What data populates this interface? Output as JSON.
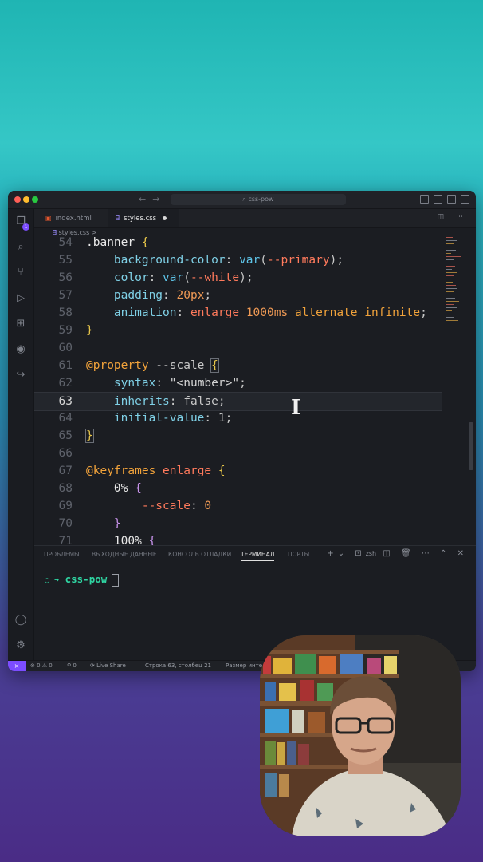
{
  "window": {
    "title": "css-pow"
  },
  "tabs": [
    {
      "label": "index.html",
      "icon": "html-file-icon"
    },
    {
      "label": "styles.css",
      "icon": "css-file-icon",
      "modified": true
    }
  ],
  "breadcrumb": {
    "file": "styles.css",
    "sep": ">"
  },
  "activity_badge": "1",
  "editor": {
    "current_line": 63,
    "lines": [
      {
        "n": "54",
        "tokens": [
          [
            "sel",
            ".banner "
          ],
          [
            "brace",
            "{"
          ]
        ]
      },
      {
        "n": "55",
        "tokens": [
          [
            "punc",
            "    "
          ],
          [
            "prop",
            "background-color"
          ],
          [
            "punc",
            ": "
          ],
          [
            "fn",
            "var"
          ],
          [
            "punc",
            "("
          ],
          [
            "var",
            "--primary"
          ],
          [
            "punc",
            ");"
          ]
        ]
      },
      {
        "n": "56",
        "tokens": [
          [
            "punc",
            "    "
          ],
          [
            "prop",
            "color"
          ],
          [
            "punc",
            ": "
          ],
          [
            "fn",
            "var"
          ],
          [
            "punc",
            "("
          ],
          [
            "var",
            "--white"
          ],
          [
            "punc",
            ");"
          ]
        ]
      },
      {
        "n": "57",
        "tokens": [
          [
            "punc",
            "    "
          ],
          [
            "prop",
            "padding"
          ],
          [
            "punc",
            ": "
          ],
          [
            "num",
            "20px"
          ],
          [
            "punc",
            ";"
          ]
        ]
      },
      {
        "n": "58",
        "tokens": [
          [
            "punc",
            "    "
          ],
          [
            "prop",
            "animation"
          ],
          [
            "punc",
            ": "
          ],
          [
            "var",
            "enlarge"
          ],
          [
            "punc",
            " "
          ],
          [
            "num",
            "1000ms"
          ],
          [
            "punc",
            " "
          ],
          [
            "kw",
            "alternate"
          ],
          [
            "punc",
            " "
          ],
          [
            "kw",
            "infinite"
          ],
          [
            "punc",
            ";"
          ]
        ]
      },
      {
        "n": "59",
        "tokens": [
          [
            "brace",
            "}"
          ]
        ]
      },
      {
        "n": "60",
        "tokens": []
      },
      {
        "n": "61",
        "tokens": [
          [
            "at",
            "@property"
          ],
          [
            "punc",
            " --scale "
          ],
          [
            "brace",
            "{"
          ]
        ]
      },
      {
        "n": "62",
        "tokens": [
          [
            "punc",
            "    "
          ],
          [
            "prop",
            "syntax"
          ],
          [
            "punc",
            ": "
          ],
          [
            "str",
            "\"<number>\""
          ],
          [
            "punc",
            ";"
          ]
        ]
      },
      {
        "n": "63",
        "tokens": [
          [
            "punc",
            "    "
          ],
          [
            "prop",
            "inherits"
          ],
          [
            "punc",
            ": "
          ],
          [
            "punc",
            "false"
          ],
          [
            "punc",
            ";"
          ]
        ]
      },
      {
        "n": "64",
        "tokens": [
          [
            "punc",
            "    "
          ],
          [
            "prop",
            "initial-value"
          ],
          [
            "punc",
            ": "
          ],
          [
            "punc",
            "1"
          ],
          [
            "punc",
            ";"
          ]
        ]
      },
      {
        "n": "65",
        "tokens": [
          [
            "brace",
            "}"
          ]
        ]
      },
      {
        "n": "66",
        "tokens": []
      },
      {
        "n": "67",
        "tokens": [
          [
            "at",
            "@keyframes"
          ],
          [
            "punc",
            " "
          ],
          [
            "var",
            "enlarge"
          ],
          [
            "punc",
            " "
          ],
          [
            "brace",
            "{"
          ]
        ]
      },
      {
        "n": "68",
        "tokens": [
          [
            "punc",
            "    "
          ],
          [
            "sel",
            "0%"
          ],
          [
            "punc",
            " "
          ],
          [
            "brace-blue",
            "{"
          ]
        ]
      },
      {
        "n": "69",
        "tokens": [
          [
            "punc",
            "        "
          ],
          [
            "var",
            "--scale"
          ],
          [
            "punc",
            ": "
          ],
          [
            "num",
            "0"
          ]
        ]
      },
      {
        "n": "70",
        "tokens": [
          [
            "punc",
            "    "
          ],
          [
            "brace-blue",
            "}"
          ]
        ]
      },
      {
        "n": "71",
        "tokens": [
          [
            "punc",
            "    "
          ],
          [
            "sel",
            "100%"
          ],
          [
            "punc",
            " "
          ],
          [
            "brace-blue",
            "{"
          ]
        ]
      }
    ]
  },
  "panel": {
    "tabs": [
      "ПРОБЛЕМЫ",
      "ВЫХОДНЫЕ ДАННЫЕ",
      "КОНСОЛЬ ОТЛАДКИ",
      "ТЕРМИНАЛ",
      "ПОРТЫ"
    ],
    "active_tab": "ТЕРМИНАЛ",
    "shell": "zsh",
    "prompt_symbol": "○ ➜",
    "prompt_dir": "css-pow"
  },
  "statusbar": {
    "errors": "⊗ 0 ⚠ 0",
    "ports": "⚲ 0",
    "live_share": "Live Share",
    "position": "Строка 63, столбец 21",
    "indent": "Размер инте"
  },
  "colors": {
    "accent": "#7c4dff",
    "editor_bg": "#1b1d22",
    "property": "#7fd0e6",
    "variable": "#ff7a5c",
    "keyword": "#f2a33b"
  }
}
